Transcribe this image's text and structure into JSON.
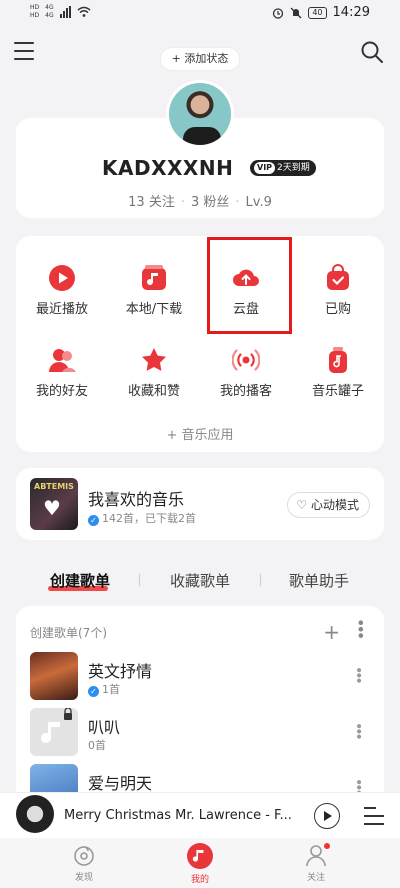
{
  "status_bar": {
    "sim1": "HD",
    "sim2": "HD",
    "net1": "4G",
    "net2": "4G",
    "battery": "40",
    "time": "14:29"
  },
  "header": {
    "add_status": "+ 添加状态"
  },
  "profile": {
    "name": "KADXXXNH",
    "vip_badge": "VIP",
    "vip_text": "2天到期",
    "follows": "13 关注",
    "fans": "3 粉丝",
    "level": "Lv.9"
  },
  "grid": {
    "items": [
      {
        "label": "最近播放",
        "icon": "play-icon"
      },
      {
        "label": "本地/下载",
        "icon": "music-folder-icon"
      },
      {
        "label": "云盘",
        "icon": "cloud-upload-icon"
      },
      {
        "label": "已购",
        "icon": "shopping-bag-icon"
      },
      {
        "label": "我的好友",
        "icon": "friends-icon"
      },
      {
        "label": "收藏和赞",
        "icon": "star-icon"
      },
      {
        "label": "我的播客",
        "icon": "broadcast-icon"
      },
      {
        "label": "音乐罐子",
        "icon": "music-jar-icon"
      }
    ],
    "apps": "+ 音乐应用"
  },
  "favorite": {
    "cover_text": "ABTEMIS",
    "title": "我喜欢的音乐",
    "subtitle": "142首，已下载2首",
    "mode_button": "心动模式"
  },
  "tabs": [
    "创建歌单",
    "收藏歌单",
    "歌单助手"
  ],
  "playlists": {
    "header": "创建歌单(7个)",
    "items": [
      {
        "title": "英文抒情",
        "subtitle": "1首",
        "verified": true
      },
      {
        "title": "叭叭",
        "subtitle": "0首",
        "verified": false
      },
      {
        "title": "爱与明天",
        "subtitle": "",
        "verified": false
      }
    ]
  },
  "player": {
    "track": "Merry Christmas Mr. Lawrence - F..."
  },
  "nav": {
    "items": [
      "发现",
      "我的",
      "关注"
    ],
    "active": "我的"
  },
  "colors": {
    "accent": "#e8363a",
    "verified": "#2b8ef0"
  }
}
